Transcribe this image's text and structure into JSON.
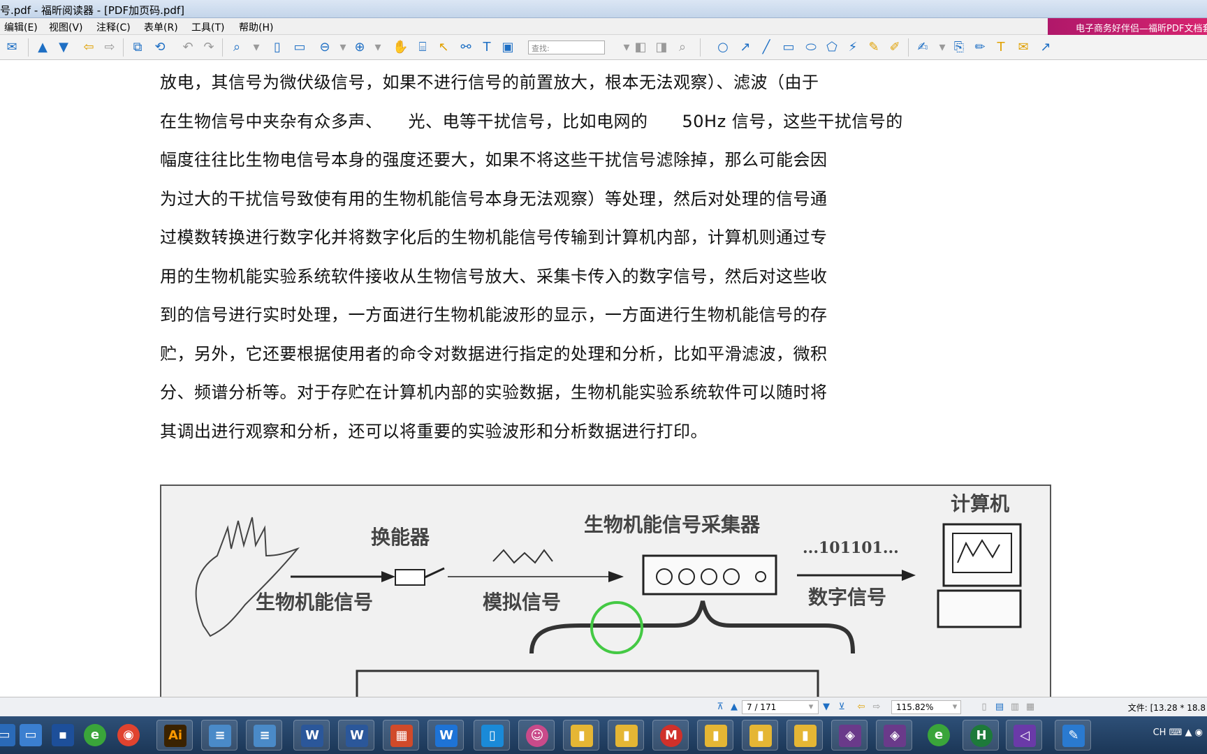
{
  "window": {
    "title": "号.pdf - 福昕阅读器 - [PDF加页码.pdf]"
  },
  "menu": [
    "编辑(E)",
    "视图(V)",
    "注释(C)",
    "表单(R)",
    "工具(T)",
    "帮助(H)"
  ],
  "ad_text": "电子商务好伴侣—福昕PDF文档套",
  "search": {
    "placeholder": "查找:"
  },
  "document": {
    "lines": [
      "放电，其信号为微伏级信号，如果不进行信号的前置放大，根本无法观察）、滤波（由于",
      "在生物信号中夹杂有众多声、　　光、电等干扰信号，比如电网的　　50Hz 信号，这些干扰信号的",
      "幅度往往比生物电信号本身的强度还要大，如果不将这些干扰信号滤除掉，那么可能会因",
      "为过大的干扰信号致使有用的生物机能信号本身无法观察）等处理，然后对处理的信号通",
      "过模数转换进行数字化并将数字化后的生物机能信号传输到计算机内部，计算机则通过专",
      "用的生物机能实验系统软件接收从生物信号放大、采集卡传入的数字信号，然后对这些收",
      "到的信号进行实时处理，一方面进行生物机能波形的显示，一方面进行生物机能信号的存",
      "贮，另外，它还要根据使用者的命令对数据进行指定的处理和分析，比如平滑滤波，微积",
      "分、频谱分析等。对于存贮在计算机内部的实验数据，生物机能实验系统软件可以随时将",
      "其调出进行观察和分析，还可以将重要的实验波形和分析数据进行打印。"
    ],
    "figure": {
      "labels": {
        "transducer": "换能器",
        "collector": "生物机能信号采集器",
        "computer": "计算机",
        "bio_signal": "生物机能信号",
        "analog_signal": "模拟信号",
        "digital_signal": "数字信号",
        "binary": "...101101..."
      }
    }
  },
  "status": {
    "page": "7 / 171",
    "zoom": "115.82%",
    "file_info": "文件: [13.28 * 18.8"
  },
  "tray": {
    "lang": "CH"
  },
  "colors": {
    "ad": "#c81e6c",
    "cursor_ring": "#44c944",
    "taskbar": "#24446a"
  }
}
